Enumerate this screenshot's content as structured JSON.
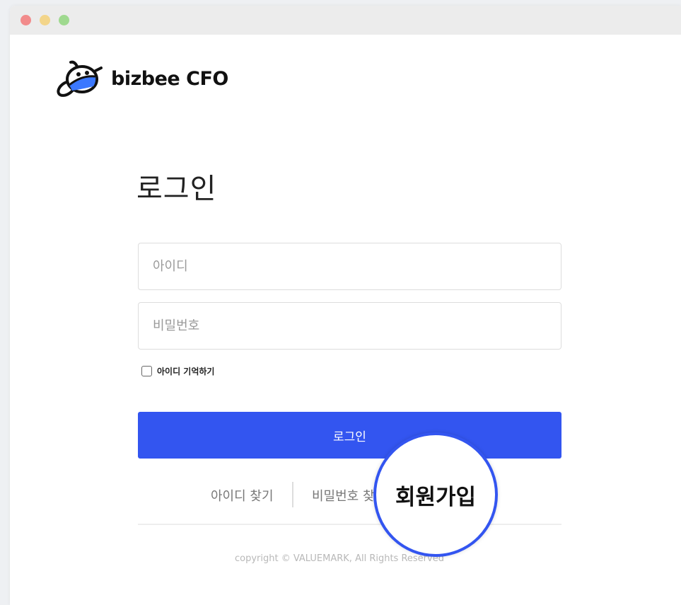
{
  "window": {
    "controls": [
      "close",
      "minimize",
      "maximize"
    ]
  },
  "brand": {
    "name": "bizbee CFO",
    "logo_icon": "bee-icon",
    "colors": {
      "accent": "#3355f0",
      "dark": "#111111"
    }
  },
  "login": {
    "title": "로그인",
    "id_placeholder": "아이디",
    "password_placeholder": "비밀번호",
    "remember_label": "아이디 기억하기",
    "remember_checked": false,
    "submit_label": "로그인"
  },
  "links": {
    "find_id": "아이디 찾기",
    "find_password": "비밀번호 찾기",
    "signup": "회원가입"
  },
  "footer": {
    "copyright": "copyright © VALUEMARK, All Rights Reserved"
  }
}
